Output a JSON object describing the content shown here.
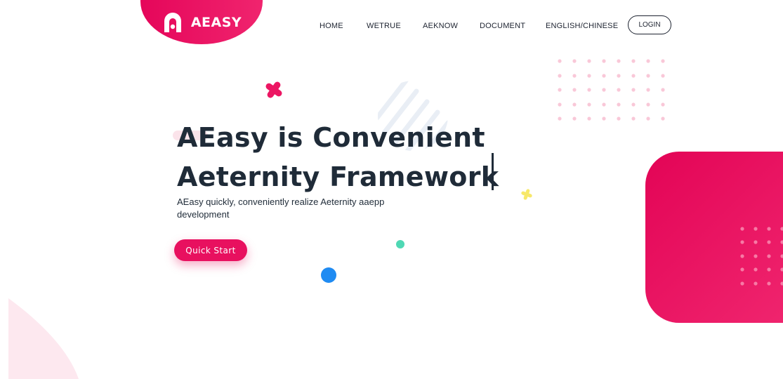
{
  "brand": {
    "name": "AEASY",
    "logo_icon": "aeasy-logo-icon",
    "color": "#e8105f"
  },
  "nav": {
    "items": [
      {
        "label": "HOME"
      },
      {
        "label": "WETRUE"
      },
      {
        "label": "AEKNOW"
      },
      {
        "label": "DOCUMENT"
      },
      {
        "label": "ENGLISH/CHINESE"
      }
    ],
    "login_label": "LOGIN"
  },
  "hero": {
    "title_line1": "AEasy is Convenient",
    "title_line2": "Aeternity Framework",
    "subtitle": "AEasy quickly, conveniently realize Aeternity aaepp development",
    "cta_label": "Quick Start"
  },
  "colors": {
    "accent": "#e8105f",
    "text_dark": "#1f2b38",
    "dot_pink": "#f7c6d6",
    "teal": "#4fd8b4",
    "blue": "#1f8bf2",
    "yellow": "#f7e86a"
  }
}
